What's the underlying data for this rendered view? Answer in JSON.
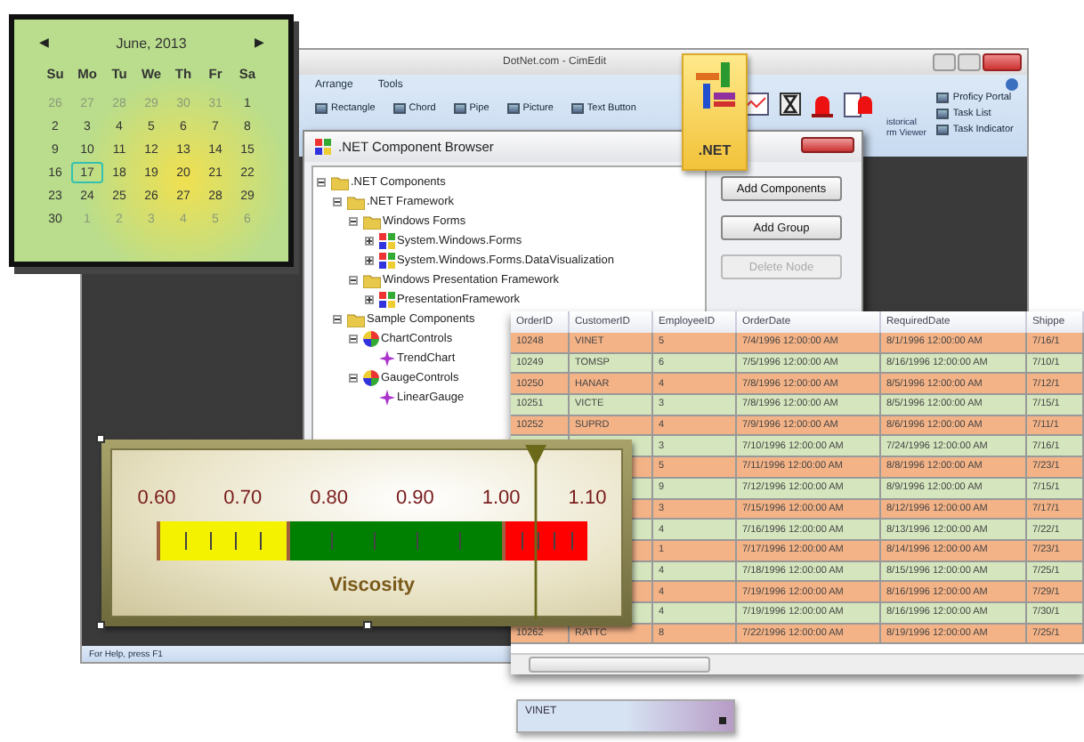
{
  "main_window": {
    "title": "DotNet.com - CimEdit",
    "ribbon_tabs": [
      {
        "label": "Arrange"
      },
      {
        "label": "Tools"
      }
    ],
    "ribbon_items": [
      {
        "label": "Rectangle"
      },
      {
        "label": "Chord"
      },
      {
        "label": "Pipe"
      },
      {
        "label": "Picture"
      },
      {
        "label": "Text Button"
      }
    ],
    "cut_item": [
      "istorical",
      "rm Viewer"
    ],
    "side_items": [
      {
        "label": "Proficy Portal"
      },
      {
        "label": "Task List"
      },
      {
        "label": "Task Indicator"
      }
    ],
    "status_bar": "For Help, press F1"
  },
  "component_browser": {
    "title": ".NET Component Browser",
    "tree": [
      {
        "label": ".NET Components",
        "kind": "folder",
        "expanded": true,
        "children": [
          {
            "label": ".NET Framework",
            "kind": "folder",
            "expanded": true,
            "children": [
              {
                "label": "Windows Forms",
                "kind": "folder",
                "expanded": true,
                "children": [
                  {
                    "label": "System.Windows.Forms",
                    "kind": "assembly",
                    "expanded": false
                  },
                  {
                    "label": "System.Windows.Forms.DataVisualization",
                    "kind": "assembly",
                    "expanded": false
                  }
                ]
              },
              {
                "label": "Windows Presentation Framework",
                "kind": "folder",
                "expanded": true,
                "children": [
                  {
                    "label": "PresentationFramework",
                    "kind": "assembly",
                    "expanded": false
                  }
                ]
              }
            ]
          },
          {
            "label": "Sample Components",
            "kind": "folder",
            "expanded": true,
            "children": [
              {
                "label": "ChartControls",
                "kind": "group",
                "expanded": true,
                "children": [
                  {
                    "label": "TrendChart",
                    "kind": "control"
                  }
                ]
              },
              {
                "label": "GaugeControls",
                "kind": "group",
                "expanded": true,
                "children": [
                  {
                    "label": "LinearGauge",
                    "kind": "control"
                  }
                ]
              }
            ]
          }
        ]
      }
    ],
    "buttons": [
      {
        "label": "Add Components",
        "disabled": false
      },
      {
        "label": "Add Group",
        "disabled": false
      },
      {
        "label": "Delete Node",
        "disabled": true
      }
    ]
  },
  "net_badge": {
    "label": ".NET"
  },
  "grid": {
    "columns": [
      "OrderID",
      "CustomerID",
      "EmployeeID",
      "OrderDate",
      "RequiredDate",
      "Shippe"
    ],
    "rows": [
      {
        "cells": [
          "10248",
          "VINET",
          "5",
          "7/4/1996 12:00:00 AM",
          "8/1/1996 12:00:00 AM",
          "7/16/1"
        ]
      },
      {
        "cells": [
          "10249",
          "TOMSP",
          "6",
          "7/5/1996 12:00:00 AM",
          "8/16/1996 12:00:00 AM",
          "7/10/1"
        ]
      },
      {
        "cells": [
          "10250",
          "HANAR",
          "4",
          "7/8/1996 12:00:00 AM",
          "8/5/1996 12:00:00 AM",
          "7/12/1"
        ]
      },
      {
        "cells": [
          "10251",
          "VICTE",
          "3",
          "7/8/1996 12:00:00 AM",
          "8/5/1996 12:00:00 AM",
          "7/15/1"
        ]
      },
      {
        "cells": [
          "10252",
          "SUPRD",
          "4",
          "7/9/1996 12:00:00 AM",
          "8/6/1996 12:00:00 AM",
          "7/11/1"
        ]
      },
      {
        "cells": [
          "3",
          "7/10/1996 12:00:00 AM",
          "7/24/1996 12:00:00 AM",
          "7/16/1"
        ]
      },
      {
        "cells": [
          "5",
          "7/11/1996 12:00:00 AM",
          "8/8/1996 12:00:00 AM",
          "7/23/1"
        ]
      },
      {
        "cells": [
          "9",
          "7/12/1996 12:00:00 AM",
          "8/9/1996 12:00:00 AM",
          "7/15/1"
        ]
      },
      {
        "cells": [
          "3",
          "7/15/1996 12:00:00 AM",
          "8/12/1996 12:00:00 AM",
          "7/17/1"
        ]
      },
      {
        "cells": [
          "4",
          "7/16/1996 12:00:00 AM",
          "8/13/1996 12:00:00 AM",
          "7/22/1"
        ]
      },
      {
        "cells": [
          "1",
          "7/17/1996 12:00:00 AM",
          "8/14/1996 12:00:00 AM",
          "7/23/1"
        ]
      },
      {
        "cells": [
          "4",
          "7/18/1996 12:00:00 AM",
          "8/15/1996 12:00:00 AM",
          "7/25/1"
        ]
      },
      {
        "cells": [
          "4",
          "7/19/1996 12:00:00 AM",
          "8/16/1996 12:00:00 AM",
          "7/29/1"
        ]
      },
      {
        "cells": [
          "4",
          "7/19/1996 12:00:00 AM",
          "8/16/1996 12:00:00 AM",
          "7/30/1"
        ]
      },
      {
        "cells": [
          "10262",
          "RATTC",
          "8",
          "7/22/1996 12:00:00 AM",
          "8/19/1996 12:00:00 AM",
          "7/25/1"
        ]
      }
    ]
  },
  "gauge": {
    "ticks": [
      "0.60",
      "0.70",
      "0.80",
      "0.90",
      "1.00",
      "1.10"
    ],
    "bands": [
      {
        "color": "#f5f200"
      },
      {
        "color": "#008000"
      },
      {
        "color": "#ff0000"
      }
    ],
    "title": "Viscosity",
    "level": 0.88
  },
  "calendar": {
    "month": "June, 2013",
    "prev": "◀",
    "next": "▶",
    "weekdays": [
      "Su",
      "Mo",
      "Tu",
      "We",
      "Th",
      "Fr",
      "Sa"
    ],
    "weeks": [
      [
        {
          "day": "26",
          "other_month": true,
          "selected": false
        },
        {
          "day": "27",
          "other_month": true,
          "selected": false
        },
        {
          "day": "28",
          "other_month": true,
          "selected": false
        },
        {
          "day": "29",
          "other_month": true,
          "selected": false
        },
        {
          "day": "30",
          "other_month": true,
          "selected": false
        },
        {
          "day": "31",
          "other_month": true,
          "selected": false
        },
        {
          "day": "1",
          "other_month": false,
          "selected": false
        }
      ],
      [
        {
          "day": "2",
          "other_month": false,
          "selected": false
        },
        {
          "day": "3",
          "other_month": false,
          "selected": false
        },
        {
          "day": "4",
          "other_month": false,
          "selected": false
        },
        {
          "day": "5",
          "other_month": false,
          "selected": false
        },
        {
          "day": "6",
          "other_month": false,
          "selected": false
        },
        {
          "day": "7",
          "other_month": false,
          "selected": false
        },
        {
          "day": "8",
          "other_month": false,
          "selected": false
        }
      ],
      [
        {
          "day": "9",
          "other_month": false,
          "selected": false
        },
        {
          "day": "10",
          "other_month": false,
          "selected": false
        },
        {
          "day": "11",
          "other_month": false,
          "selected": false
        },
        {
          "day": "12",
          "other_month": false,
          "selected": false
        },
        {
          "day": "13",
          "other_month": false,
          "selected": false
        },
        {
          "day": "14",
          "other_month": false,
          "selected": false
        },
        {
          "day": "15",
          "other_month": false,
          "selected": false
        }
      ],
      [
        {
          "day": "16",
          "other_month": false,
          "selected": false
        },
        {
          "day": "17",
          "other_month": false,
          "selected": true
        },
        {
          "day": "18",
          "other_month": false,
          "selected": false
        },
        {
          "day": "19",
          "other_month": false,
          "selected": false
        },
        {
          "day": "20",
          "other_month": false,
          "selected": false
        },
        {
          "day": "21",
          "other_month": false,
          "selected": false
        },
        {
          "day": "22",
          "other_month": false,
          "selected": false
        }
      ],
      [
        {
          "day": "23",
          "other_month": false,
          "selected": false
        },
        {
          "day": "24",
          "other_month": false,
          "selected": false
        },
        {
          "day": "25",
          "other_month": false,
          "selected": false
        },
        {
          "day": "26",
          "other_month": false,
          "selected": false
        },
        {
          "day": "27",
          "other_month": false,
          "selected": false
        },
        {
          "day": "28",
          "other_month": false,
          "selected": false
        },
        {
          "day": "29",
          "other_month": false,
          "selected": false
        }
      ],
      [
        {
          "day": "30",
          "other_month": false,
          "selected": false
        },
        {
          "day": "1",
          "other_month": true,
          "selected": false
        },
        {
          "day": "2",
          "other_month": true,
          "selected": false
        },
        {
          "day": "3",
          "other_month": true,
          "selected": false
        },
        {
          "day": "4",
          "other_month": true,
          "selected": false
        },
        {
          "day": "5",
          "other_month": true,
          "selected": false
        },
        {
          "day": "6",
          "other_month": true,
          "selected": false
        }
      ]
    ]
  },
  "dropdown": {
    "value": "VINET"
  }
}
